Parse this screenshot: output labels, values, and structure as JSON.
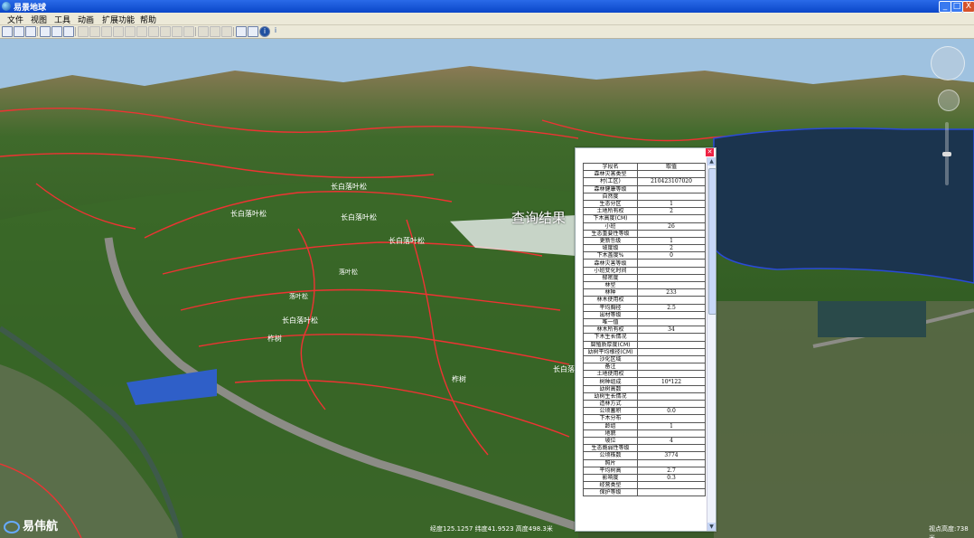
{
  "window": {
    "title": "易景地球",
    "minimize": "_",
    "maximize": "□",
    "close": "X"
  },
  "menu": [
    {
      "label": "文件"
    },
    {
      "label": "视图"
    },
    {
      "label": "工具"
    },
    {
      "label": "动画"
    },
    {
      "label": "扩展功能"
    },
    {
      "label": "帮助"
    }
  ],
  "toolbar_icons": [
    "new-icon",
    "open-icon",
    "save-icon",
    "layer-icon",
    "tree-icon",
    "grid-icon",
    "print-icon",
    "measure-icon",
    "rotate-icon",
    "refresh-icon",
    "record-icon",
    "redo-icon",
    "play-icon",
    "stop-icon",
    "copy-icon",
    "export-icon",
    "split-icon",
    "tile-icon",
    "window-icon",
    "tree-view-icon",
    "table-view-icon",
    "info-icon",
    "help-icon"
  ],
  "map": {
    "result_label": "查询结果",
    "logo_text": "易伟航",
    "coords": "经度125.1257 纬度41.9523 高度498.3米",
    "view_height": "视点高度:738米",
    "parcel_labels": [
      "长白落叶松",
      "长白落叶松",
      "长白落叶松",
      "长白落叶松",
      "落叶松",
      "落叶松",
      "长白落叶松",
      "柞树",
      "柞树",
      "长白落叶松"
    ]
  },
  "attribute_table": {
    "header": {
      "field": "字段名",
      "value": "取值"
    },
    "rows": [
      {
        "field": "森林灾害类型",
        "value": ""
      },
      {
        "field": "村(工区)",
        "value": "210423107020"
      },
      {
        "field": "森林健康等级",
        "value": ""
      },
      {
        "field": "自然度",
        "value": ""
      },
      {
        "field": "生态分区",
        "value": "1"
      },
      {
        "field": "土地所有权",
        "value": "2"
      },
      {
        "field": "下木高度(CM)",
        "value": ""
      },
      {
        "field": "小班",
        "value": "26"
      },
      {
        "field": "生态重要性等级",
        "value": ""
      },
      {
        "field": "更新등级",
        "value": "1"
      },
      {
        "field": "坡度级",
        "value": "2"
      },
      {
        "field": "下木盖度%",
        "value": "0"
      },
      {
        "field": "森林灾害等级",
        "value": ""
      },
      {
        "field": "小班变化时间",
        "value": ""
      },
      {
        "field": "郁密度",
        "value": ""
      },
      {
        "field": "林型",
        "value": ""
      },
      {
        "field": "林种",
        "value": "233"
      },
      {
        "field": "林木使用权",
        "value": ""
      },
      {
        "field": "平均胸径",
        "value": "2.5"
      },
      {
        "field": "出材等级",
        "value": ""
      },
      {
        "field": "唯一值",
        "value": ""
      },
      {
        "field": "林木所有权",
        "value": "34"
      },
      {
        "field": "下木生长情况",
        "value": ""
      },
      {
        "field": "腐殖质厚度(CM)",
        "value": ""
      },
      {
        "field": "幼树平均根径(CM)",
        "value": ""
      },
      {
        "field": "沙化区域",
        "value": ""
      },
      {
        "field": "备注",
        "value": ""
      },
      {
        "field": "土地使用权",
        "value": ""
      },
      {
        "field": "树种组成",
        "value": "10*122"
      },
      {
        "field": "幼树高数",
        "value": ""
      },
      {
        "field": "幼树生长情况",
        "value": ""
      },
      {
        "field": "造林方式",
        "value": ""
      },
      {
        "field": "公顷蓄积",
        "value": "0.0"
      },
      {
        "field": "下木分布",
        "value": ""
      },
      {
        "field": "龄组",
        "value": "1"
      },
      {
        "field": "地貌",
        "value": ""
      },
      {
        "field": "坡位",
        "value": "4"
      },
      {
        "field": "生态脆弱性等级",
        "value": ""
      },
      {
        "field": "公顷株数",
        "value": "3774"
      },
      {
        "field": "照片",
        "value": ""
      },
      {
        "field": "平均树高",
        "value": "2.7"
      },
      {
        "field": "影响度",
        "value": "0.3"
      },
      {
        "field": "经营类型",
        "value": ""
      },
      {
        "field": "保护等级",
        "value": ""
      }
    ]
  }
}
